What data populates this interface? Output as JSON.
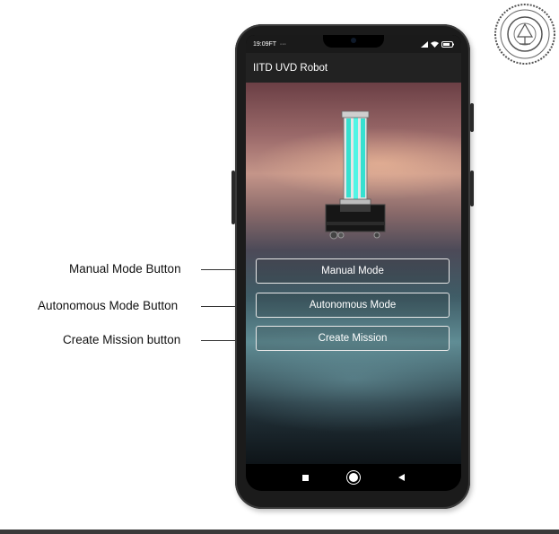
{
  "annotations": [
    {
      "text": "Manual Mode Button"
    },
    {
      "text": "Autonomous Mode Button"
    },
    {
      "text": "Create Mission button"
    }
  ],
  "status_bar": {
    "time": "19:09",
    "carrier": "FT",
    "dots": "···"
  },
  "app_bar": {
    "title": "IITD UVD Robot"
  },
  "buttons": {
    "manual": "Manual Mode",
    "autonomous": "Autonomous Mode",
    "create_mission": "Create Mission"
  },
  "nav_icons": [
    "square-icon",
    "circle-icon",
    "triangle-back-icon"
  ]
}
